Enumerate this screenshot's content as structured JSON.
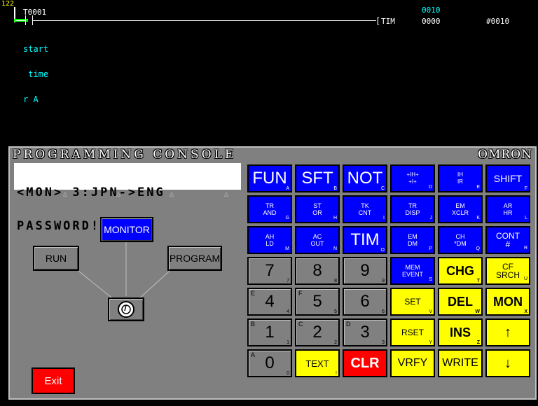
{
  "ladder": {
    "line_number": "122",
    "contact_label": "T0001",
    "comment_lines": [
      "start",
      " time",
      "r A"
    ],
    "instruction": "TIM",
    "timer_number_top": "0010",
    "timer_number": "0000",
    "set_value": "#0010"
  },
  "console": {
    "title": "PROGRAMMING CONSOLE",
    "brand": "OMRON",
    "lcd_line1": "<MON> 3:JPN->ENG",
    "lcd_line2": "PASSWORD!",
    "modes": {
      "monitor": "MONITOR",
      "run": "RUN",
      "program": "PROGRAM"
    },
    "exit_label": "Exit",
    "keys": {
      "fun": {
        "label": "FUN",
        "sub": "A"
      },
      "sft": {
        "label": "SFT",
        "sub": "B"
      },
      "not": {
        "label": "NOT",
        "sub": "C"
      },
      "shift": {
        "label": "SHIFT",
        "sub": "F"
      },
      "tr_and": {
        "label": "TR\nAND",
        "sub": "G"
      },
      "st_or": {
        "label": "ST\nOR",
        "sub": "H"
      },
      "tk_cnt": {
        "label": "TK\nCNT",
        "sub": "I"
      },
      "tr_disp": {
        "label": "TR\nDISP",
        "sub": "J"
      },
      "em_xclr": {
        "label": "EM\nXCLR",
        "sub": "K"
      },
      "ar_hr": {
        "label": "AR\nHR",
        "sub": "L"
      },
      "ah_ld": {
        "label": "AH\nLD",
        "sub": "M"
      },
      "ac_out": {
        "label": "AC\nOUT",
        "sub": "N"
      },
      "tim": {
        "label": "TIM",
        "sub": "O"
      },
      "em_dm": {
        "label": "EM\nDM",
        "sub": "P"
      },
      "ch_dm": {
        "label": "CH\n*DM",
        "sub": "Q"
      },
      "cont": {
        "label": "CONT\n#",
        "sub": "R"
      },
      "n7": {
        "label": "7",
        "sub": "7"
      },
      "n8": {
        "label": "8",
        "sub": "8"
      },
      "n9": {
        "label": "9",
        "sub": "9"
      },
      "em_event": {
        "label": "MEM\nEVENT",
        "sub": "S"
      },
      "chg": {
        "label": "CHG",
        "sub": "T"
      },
      "cf_srch": {
        "label": "CF\nSRCH",
        "sub": "U"
      },
      "n4": {
        "label": "4",
        "sub": "4",
        "corner": "E"
      },
      "n5": {
        "label": "5",
        "sub": "5",
        "corner": "F"
      },
      "n6": {
        "label": "6",
        "sub": "6"
      },
      "set": {
        "label": "SET",
        "sub": "V"
      },
      "del": {
        "label": "DEL",
        "sub": "W"
      },
      "mon": {
        "label": "MON",
        "sub": "X"
      },
      "n1": {
        "label": "1",
        "sub": "1",
        "corner": "B"
      },
      "n2": {
        "label": "2",
        "sub": "2",
        "corner": "C"
      },
      "n3": {
        "label": "3",
        "sub": "3",
        "corner": "D"
      },
      "rset": {
        "label": "RSET",
        "sub": "Y"
      },
      "ins": {
        "label": "INS",
        "sub": "Z"
      },
      "up": {
        "label": "↑"
      },
      "n0": {
        "label": "0",
        "sub": "0",
        "corner": "A"
      },
      "text": {
        "label": "TEXT",
        "sub": "!"
      },
      "clr": {
        "label": "CLR"
      },
      "vrfy": {
        "label": "VRFY"
      },
      "write": {
        "label": "WRITE"
      },
      "down": {
        "label": "↓"
      }
    }
  },
  "colors": {
    "blue_key": "#0000ff",
    "yellow_key": "#ffff00",
    "red_key": "#ff0000",
    "console_bg": "#808080",
    "ladder_comment": "#00ffff"
  }
}
